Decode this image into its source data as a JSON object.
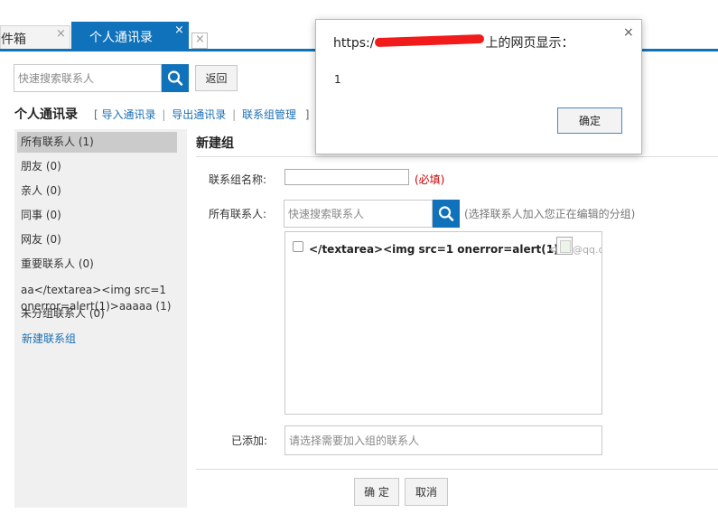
{
  "tabs": {
    "mail_label": "件箱",
    "contacts_label": "个人通讯录",
    "close_glyph": "×"
  },
  "toolbar": {
    "search_placeholder": "快速搜索联系人",
    "back_label": "返回"
  },
  "section": {
    "title": "个人通讯录",
    "bracket_open": "[",
    "bracket_close": "]",
    "separator": "|",
    "links": [
      "导入通讯录",
      "导出通讯录",
      "联系组管理"
    ]
  },
  "sidebar": {
    "items": [
      {
        "label": "所有联系人 (1)",
        "active": true
      },
      {
        "label": "朋友 (0)"
      },
      {
        "label": "亲人 (0)"
      },
      {
        "label": "同事 (0)"
      },
      {
        "label": "网友 (0)"
      },
      {
        "label": "重要联系人 (0)"
      }
    ],
    "injected_group": "aa</textarea><img src=1 onerror=alert(1)>aaaaa (1)",
    "ungrouped": "未分组联系人 (0)",
    "new_group": "新建联系组"
  },
  "form": {
    "title": "新建组",
    "group_name_label": "联系组名称:",
    "required_note": "(必填)",
    "all_contacts_label": "所有联系人:",
    "search_placeholder": "快速搜索联系人",
    "hint": "(选择联系人加入您正在编辑的分组)",
    "contact_name": "</textarea><img src=1 onerror=alert(1)>",
    "contact_lt": "<",
    "contact_email": "@qq.c",
    "added_label": "已添加:",
    "added_placeholder": "请选择需要加入组的联系人",
    "ok_label": "确 定",
    "cancel_label": "取消"
  },
  "dialog": {
    "title_prefix": "https:/",
    "title_suffix": "上的网页显示：",
    "message": "1",
    "ok_label": "确定",
    "close_glyph": "×"
  },
  "colors": {
    "accent": "#0f72ba",
    "link": "#1a6fb4",
    "required": "#cc0000",
    "redaction": "#f21b1b"
  },
  "icons": {
    "search": "magnifier-icon",
    "close": "close-icon",
    "broken_image": "broken-image-icon"
  }
}
